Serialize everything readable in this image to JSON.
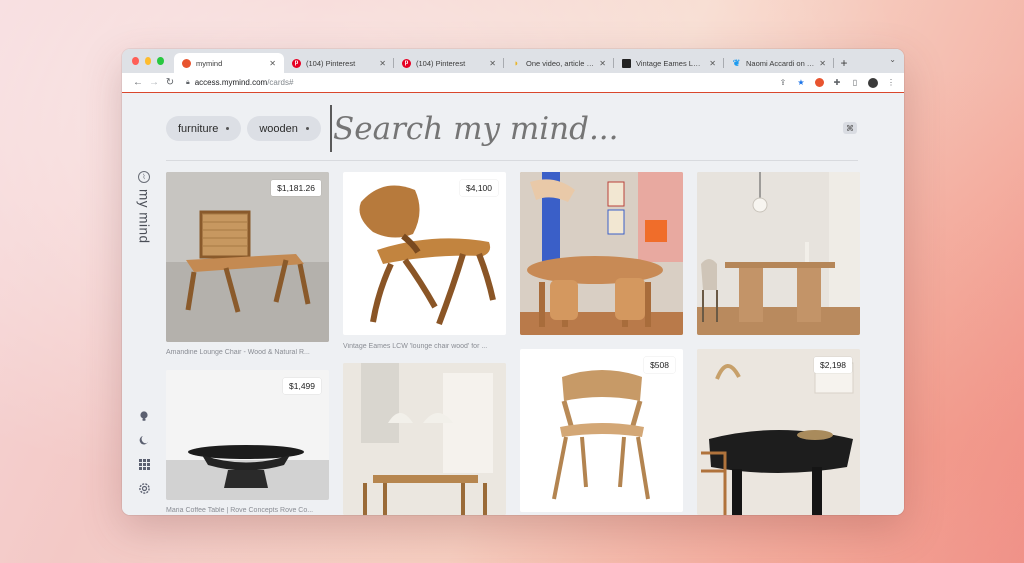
{
  "browser": {
    "tabs": [
      {
        "title": "mymind",
        "icon": "mymind-favicon-icon",
        "active": true
      },
      {
        "title": "(104) Pinterest",
        "icon": "pinterest-icon",
        "active": false
      },
      {
        "title": "(104) Pinterest",
        "icon": "pinterest-icon",
        "active": false
      },
      {
        "title": "One video, article or sit…",
        "icon": "banana-icon",
        "active": false
      },
      {
        "title": "Vintage Eames LCW 'lo…",
        "icon": "page-favicon-icon",
        "active": false
      },
      {
        "title": "Naomi Accardi on Twitte…",
        "icon": "twitter-icon",
        "active": false
      }
    ],
    "new_tab_label": "+",
    "url_domain": "access.mymind.com",
    "url_path": "/cards#",
    "accent": "#d9472c"
  },
  "search": {
    "tags": [
      {
        "label": "furniture"
      },
      {
        "label": "wooden"
      }
    ],
    "placeholder": "Search my mind...",
    "shortcut": "⌘"
  },
  "brand": {
    "name": "my mind"
  },
  "cards": [
    {
      "price": "$1,181.26",
      "caption": "Amandine Lounge Chair - Wood & Natural R...",
      "image": "lounge-chair-photo"
    },
    {
      "price": "$1,499",
      "caption": "Maria Coffee Table | Rove Concepts Rove Co...",
      "image": "coffee-table-photo"
    },
    {
      "price": "$4,100",
      "caption": "Vintage Eames LCW 'lounge chair wood' for ...",
      "image": "eames-chair-photo"
    },
    {
      "price": "",
      "caption": "",
      "image": "dining-room-photo"
    },
    {
      "price": "",
      "caption": "",
      "image": "colorful-dining-room-photo"
    },
    {
      "price": "$508",
      "caption": "",
      "image": "wooden-chair-photo"
    },
    {
      "price": "",
      "caption": "",
      "image": "dining-table-pendant-photo"
    },
    {
      "price": "$2,198",
      "caption": "",
      "image": "black-dining-table-photo"
    }
  ]
}
